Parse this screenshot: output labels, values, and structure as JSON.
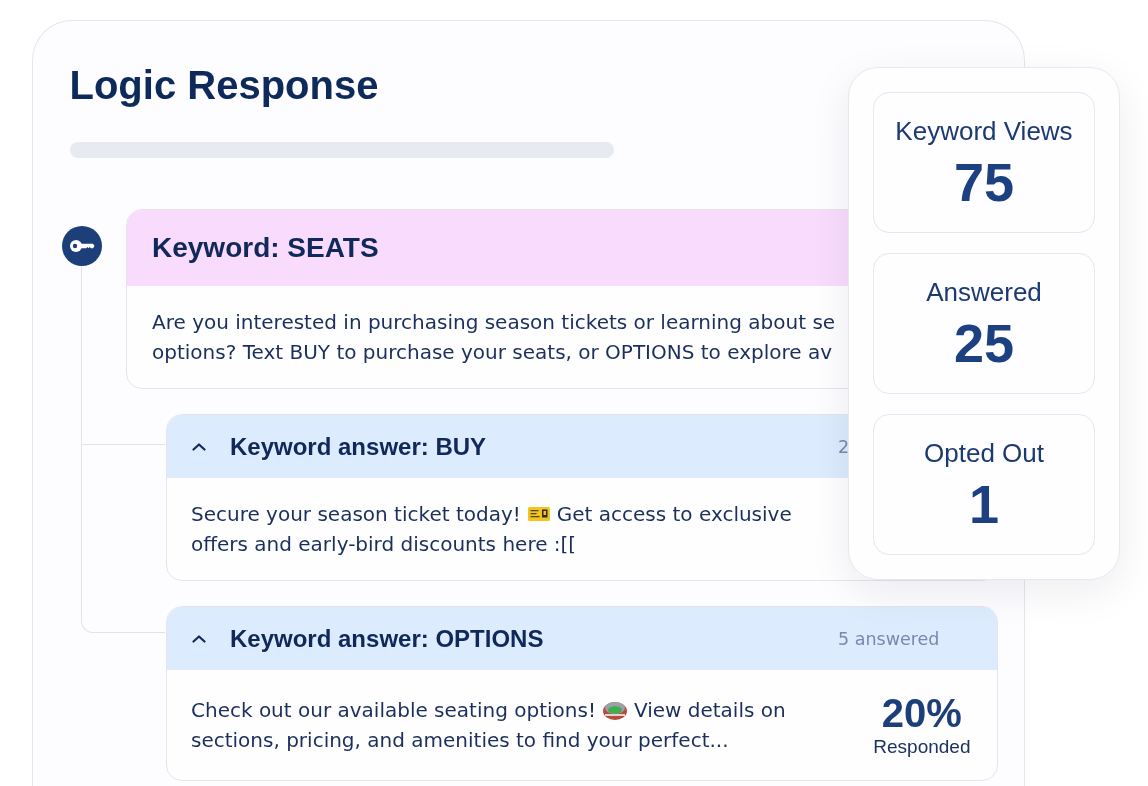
{
  "title": "Logic Response",
  "keyword": {
    "header": "Keyword: SEATS",
    "message_lines": [
      [
        {
          "kind": "text",
          "text": "Are you interested in purchasing season tickets or learning about se"
        }
      ],
      [
        {
          "kind": "text",
          "text": "options? Text BUY to purchase your seats, or OPTIONS to explore av"
        }
      ]
    ]
  },
  "answers": [
    {
      "header": "Keyword answer: BUY",
      "expanded": true,
      "answered": "2",
      "message_lines": [
        [
          {
            "kind": "text",
            "text": "Secure your season ticket today!"
          },
          {
            "kind": "ticket"
          },
          {
            "kind": "text",
            "text": "Get access to exclusive"
          }
        ],
        [
          {
            "kind": "text",
            "text": "offers and early-bird discounts here :[["
          }
        ]
      ]
    },
    {
      "header": "Keyword answer: OPTIONS",
      "expanded": true,
      "answered": "5 answered",
      "message_lines": [
        [
          {
            "kind": "text",
            "text": "Check out our available seating options!"
          },
          {
            "kind": "stadium"
          },
          {
            "kind": "text",
            "text": "View details on"
          }
        ],
        [
          {
            "kind": "text",
            "text": "sections, pricing, and amenities to find your perfect..."
          }
        ]
      ],
      "rate": "20%",
      "rate_label": "Responded"
    }
  ],
  "stats": [
    {
      "label": "Keyword Views",
      "value": "75"
    },
    {
      "label": "Answered",
      "value": "25"
    },
    {
      "label": "Opted Out",
      "value": "1"
    }
  ]
}
